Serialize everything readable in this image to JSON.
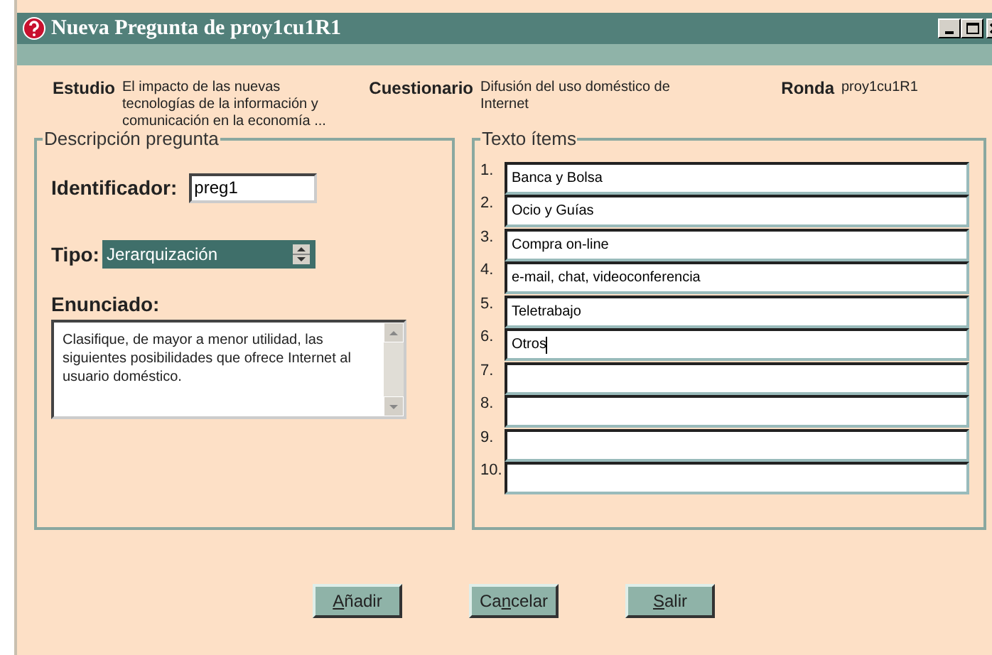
{
  "window": {
    "title": "Nueva Pregunta de proy1cu1R1"
  },
  "header": [
    {
      "label": "Estudio",
      "value": "El impacto de las nuevas tecnologías de la información  y comunicación en la economía ..."
    },
    {
      "label": "Cuestionario",
      "value": "Difusión del uso doméstico de Internet"
    },
    {
      "label": "Ronda",
      "value": "proy1cu1R1"
    }
  ],
  "descripcion": {
    "title": "Descripción pregunta",
    "identificador_label": "Identificador:",
    "identificador": "preg1",
    "tipo_label": "Tipo:",
    "tipo": "Jerarquización",
    "enunciado_label": "Enunciado:",
    "enunciado": "Clasifique, de mayor a menor utilidad, las siguientes posibilidades que ofrece Internet al usuario doméstico."
  },
  "items": {
    "title": "Texto ítems",
    "rows": [
      {
        "number": "1.",
        "value": "Banca y Bolsa",
        "focused": false
      },
      {
        "number": "2.",
        "value": "Ocio y Guías",
        "focused": false
      },
      {
        "number": "3.",
        "value": "Compra on-line",
        "focused": false
      },
      {
        "number": "4.",
        "value": "e-mail, chat, videoconferencia",
        "focused": false
      },
      {
        "number": "5.",
        "value": "Teletrabajo",
        "focused": false
      },
      {
        "number": "6.",
        "value": "Otros",
        "focused": true
      },
      {
        "number": "7.",
        "focused": false
      },
      {
        "number": "8.",
        "focused": false
      },
      {
        "number": "9.",
        "focused": false
      },
      {
        "number": "10.",
        "focused": false
      }
    ]
  },
  "buttons": [
    {
      "key": "A",
      "post": "ñadir"
    },
    {
      "pre": "Ca",
      "key": "n",
      "post": "celar"
    },
    {
      "key": "S",
      "post": "alir"
    }
  ]
}
